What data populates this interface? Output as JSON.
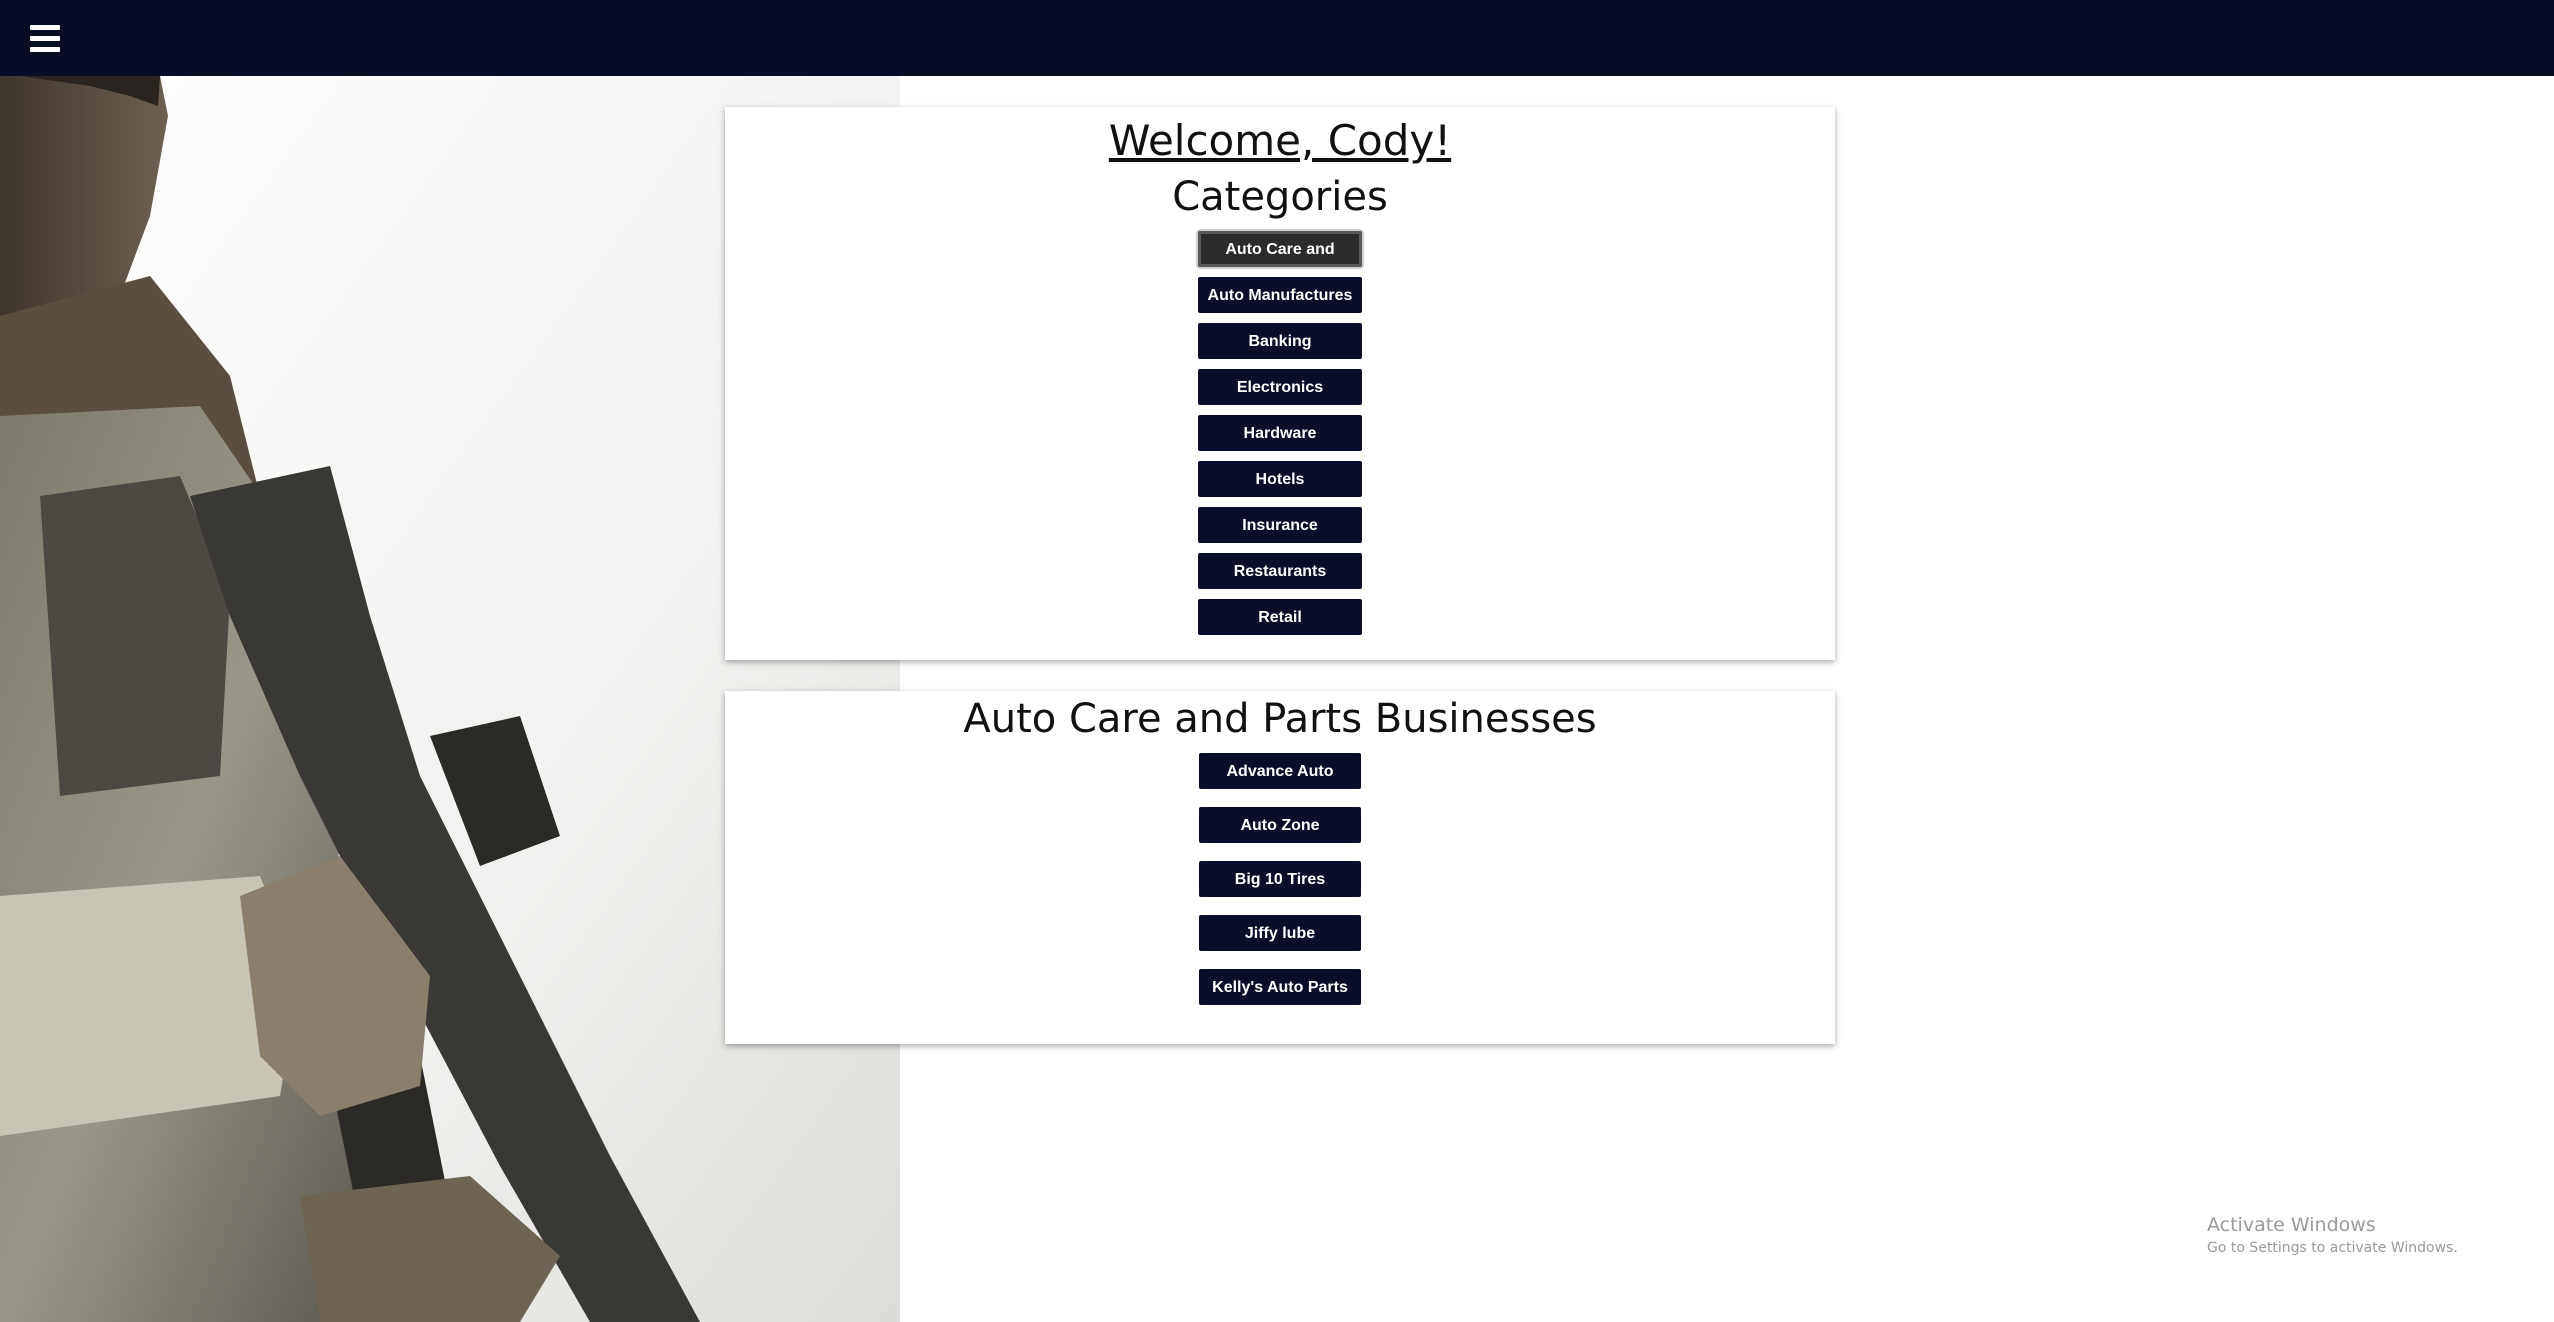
{
  "topbar": {
    "menu_icon": "hamburger-menu-icon"
  },
  "background": {
    "image": "soldier-with-rifle-photo"
  },
  "categories_card": {
    "welcome": "Welcome, Cody!",
    "title": "Categories",
    "items": [
      {
        "label": "Auto Care and Parts",
        "active": true
      },
      {
        "label": "Auto Manufactures",
        "active": false
      },
      {
        "label": "Banking",
        "active": false
      },
      {
        "label": "Electronics",
        "active": false
      },
      {
        "label": "Hardware",
        "active": false
      },
      {
        "label": "Hotels",
        "active": false
      },
      {
        "label": "Insurance",
        "active": false
      },
      {
        "label": "Restaurants",
        "active": false
      },
      {
        "label": "Retail",
        "active": false
      }
    ]
  },
  "businesses_card": {
    "title": "Auto Care and Parts Businesses",
    "items": [
      {
        "label": "Advance Auto Parts"
      },
      {
        "label": "Auto Zone"
      },
      {
        "label": "Big 10 Tires"
      },
      {
        "label": "Jiffy lube"
      },
      {
        "label": "Kelly's Auto Parts"
      }
    ]
  },
  "watermark": {
    "title": "Activate Windows",
    "subtitle": "Go to Settings to activate Windows."
  },
  "colors": {
    "topbar": "#070d24",
    "button": "#0b0e2b",
    "button_active": "#2b2b2b"
  }
}
